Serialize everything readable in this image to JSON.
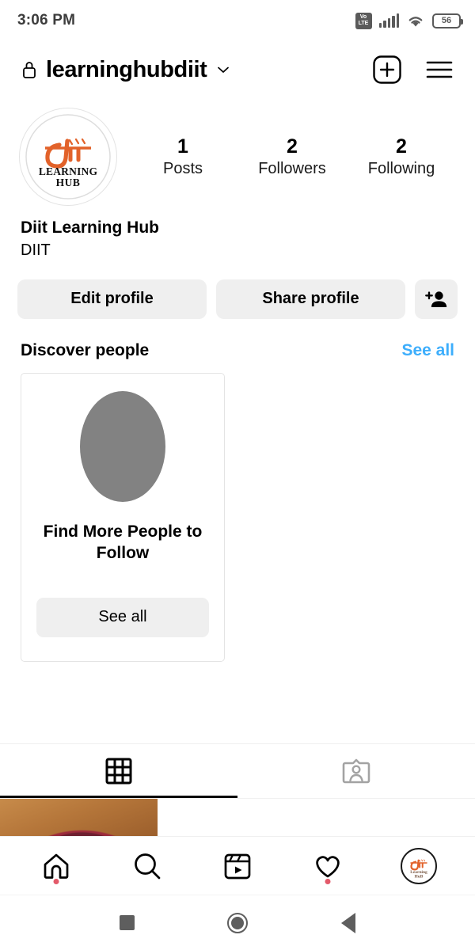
{
  "status_bar": {
    "time": "3:06 PM",
    "network_badge_top": "Vo",
    "network_badge_bottom": "LTE",
    "signal_icon": "signal-bars-icon",
    "wifi_icon": "wifi-icon",
    "battery_level": "56"
  },
  "header": {
    "lock_icon": "lock-icon",
    "username": "learninghubdiit",
    "chevron_icon": "chevron-down-icon",
    "add_icon": "plus-box-icon",
    "menu_icon": "hamburger-menu-icon"
  },
  "profile": {
    "avatar_alt": "diit-learning-hub-logo",
    "display_name": "Diit Learning Hub",
    "bio": "DIIT",
    "stats": [
      {
        "value": "1",
        "label": "Posts"
      },
      {
        "value": "2",
        "label": "Followers"
      },
      {
        "value": "2",
        "label": "Following"
      }
    ],
    "buttons": {
      "edit_profile": "Edit profile",
      "share_profile": "Share profile",
      "discover_people_icon": "person-add-icon"
    }
  },
  "discover": {
    "title": "Discover people",
    "see_all": "See all",
    "cards": [
      {
        "avatar": "placeholder-avatar",
        "text": "Find More People to Follow",
        "button_label": "See all"
      }
    ]
  },
  "tabs": [
    {
      "name": "grid-tab",
      "icon": "grid-icon",
      "active": true
    },
    {
      "name": "tagged-tab",
      "icon": "tagged-person-icon",
      "active": false
    }
  ],
  "posts": [
    {
      "alt": "post-thumbnail-1"
    }
  ],
  "bottom_nav": [
    {
      "name": "home",
      "icon": "home-icon",
      "badge": true
    },
    {
      "name": "search",
      "icon": "search-icon",
      "badge": false
    },
    {
      "name": "reels",
      "icon": "reels-icon",
      "badge": false
    },
    {
      "name": "activity",
      "icon": "heart-icon",
      "badge": true
    },
    {
      "name": "profile",
      "icon": "profile-avatar-icon",
      "badge": false,
      "active": true
    }
  ],
  "system_nav": {
    "recents": "recents-square-button",
    "home": "home-circle-button",
    "back": "back-triangle-button"
  },
  "colors": {
    "link_blue": "#3daefc",
    "button_gray": "#efefef",
    "badge_red": "#e35a6a",
    "logo_orange": "#e2622a",
    "placeholder_gray": "#828282"
  }
}
